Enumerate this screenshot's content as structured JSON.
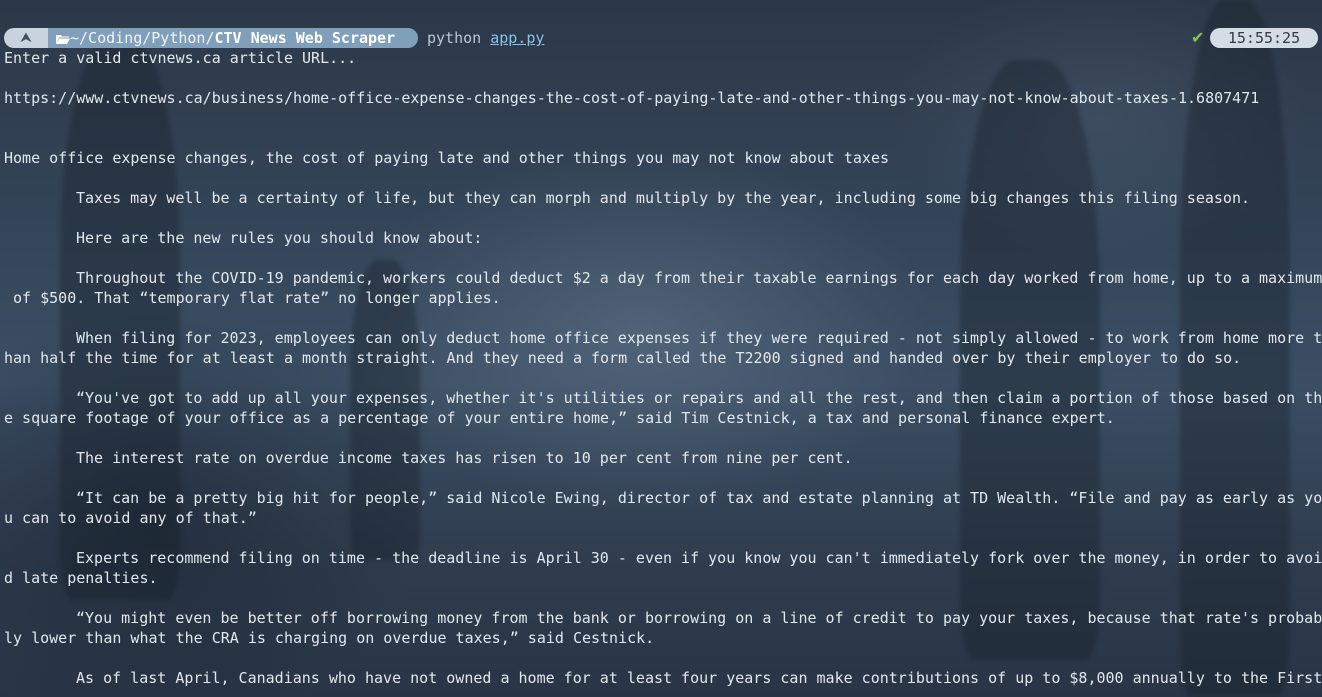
{
  "prompt": {
    "path_prefix": "~/Coding/Python/",
    "path_current": "CTV News Web Scraper",
    "command": "python",
    "argument": "app.py",
    "status_check": "✔",
    "time": "15:55:25"
  },
  "output": {
    "prompt_text": "Enter a valid ctvnews.ca article URL...",
    "url": "https://www.ctvnews.ca/business/home-office-expense-changes-the-cost-of-paying-late-and-other-things-you-may-not-know-about-taxes-1.6807471",
    "title": "Home office expense changes, the cost of paying late and other things you may not know about taxes",
    "lines": [
      "Taxes may well be a certainty of life, but they can morph and multiply by the year, including some big changes this filing season.",
      "Here are the new rules you should know about:",
      "Throughout the COVID-19 pandemic, workers could deduct $2 a day from their taxable earnings for each day worked from home, up to a maximum",
      " of $500. That “temporary flat rate” no longer applies.",
      "When filing for 2023, employees can only deduct home office expenses if they were required - not simply allowed - to work from home more t",
      "han half the time for at least a month straight. And they need a form called the T2200 signed and handed over by their employer to do so.",
      "“You've got to add up all your expenses, whether it's utilities or repairs and all the rest, and then claim a portion of those based on th",
      "e square footage of your office as a percentage of your entire home,” said Tim Cestnick, a tax and personal finance expert.",
      "The interest rate on overdue income taxes has risen to 10 per cent from nine per cent.",
      "“It can be a pretty big hit for people,” said Nicole Ewing, director of tax and estate planning at TD Wealth. “File and pay as early as yo",
      "u can to avoid any of that.”",
      "Experts recommend filing on time - the deadline is April 30 - even if you know you can't immediately fork over the money, in order to avoi",
      "d late penalties.",
      "“You might even be better off borrowing money from the bank or borrowing on a line of credit to pay your taxes, because that rate's probab",
      "ly lower than what the CRA is charging on overdue taxes,” said Cestnick.",
      "As of last April, Canadians who have not owned a home for at least four years can make contributions of up to $8,000 annually to the First"
    ]
  }
}
